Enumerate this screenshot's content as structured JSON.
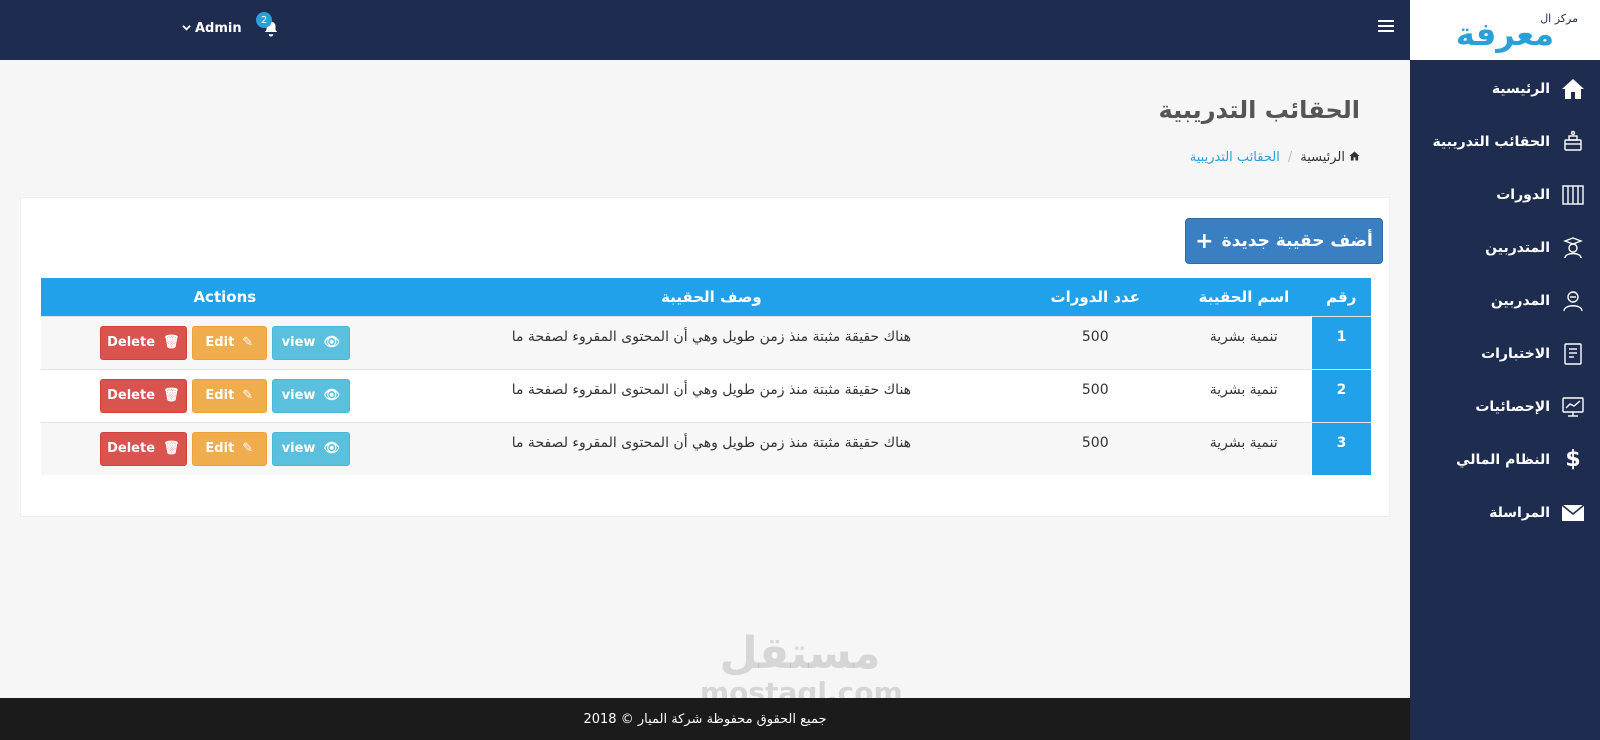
{
  "logo": {
    "small": "مركز ال",
    "main": "معرفة"
  },
  "topbar": {
    "admin_label": "Admin",
    "notification_count": "2"
  },
  "sidebar": {
    "items": [
      {
        "label": "الرئيسية",
        "icon": "home-icon"
      },
      {
        "label": "الحقائب التدريبية",
        "icon": "training-bag-icon"
      },
      {
        "label": "الدورات",
        "icon": "courses-icon"
      },
      {
        "label": "المتدربين",
        "icon": "trainee-icon"
      },
      {
        "label": "المدربين",
        "icon": "trainer-icon"
      },
      {
        "label": "الاختبارات",
        "icon": "exam-icon"
      },
      {
        "label": "الإحصائيات",
        "icon": "stats-icon"
      },
      {
        "label": "النظام المالي",
        "icon": "dollar-icon"
      },
      {
        "label": "المراسلة",
        "icon": "envelope-icon"
      }
    ]
  },
  "page": {
    "title": "الحقائب التدريبية",
    "breadcrumb": {
      "home": "الرئيسية",
      "current": "الحقائب التدريبية"
    },
    "add_button": "أضف حقيبة جديدة"
  },
  "table": {
    "headers": {
      "number": "رقم",
      "name": "اسم الحقيبة",
      "courses": "عدد الدورات",
      "description": "وصف الحقيبة",
      "actions": "Actions"
    },
    "rows": [
      {
        "number": "1",
        "name": "تنمية بشرية",
        "courses": "500",
        "description": "هناك حقيقة مثبتة منذ زمن طويل وهي أن المحتوى المقروء لصفحة ما"
      },
      {
        "number": "2",
        "name": "تنمية بشرية",
        "courses": "500",
        "description": "هناك حقيقة مثبتة منذ زمن طويل وهي أن المحتوى المقروء لصفحة ما"
      },
      {
        "number": "3",
        "name": "تنمية بشرية",
        "courses": "500",
        "description": "هناك حقيقة مثبتة منذ زمن طويل وهي أن المحتوى المقروء لصفحة ما"
      }
    ],
    "buttons": {
      "view": "view",
      "edit": "Edit",
      "delete": "Delete"
    }
  },
  "footer": {
    "text": "جميع الحقوق محفوظة شركة الميار © 2018"
  },
  "watermark": {
    "line1": "مستقل",
    "line2": "mostaql.com"
  },
  "colors": {
    "navy": "#1e2d4f",
    "accent": "#22a1eb",
    "add": "#3a7fc1",
    "view": "#5bc0de",
    "edit": "#f0ad4e",
    "delete": "#d9534f"
  }
}
